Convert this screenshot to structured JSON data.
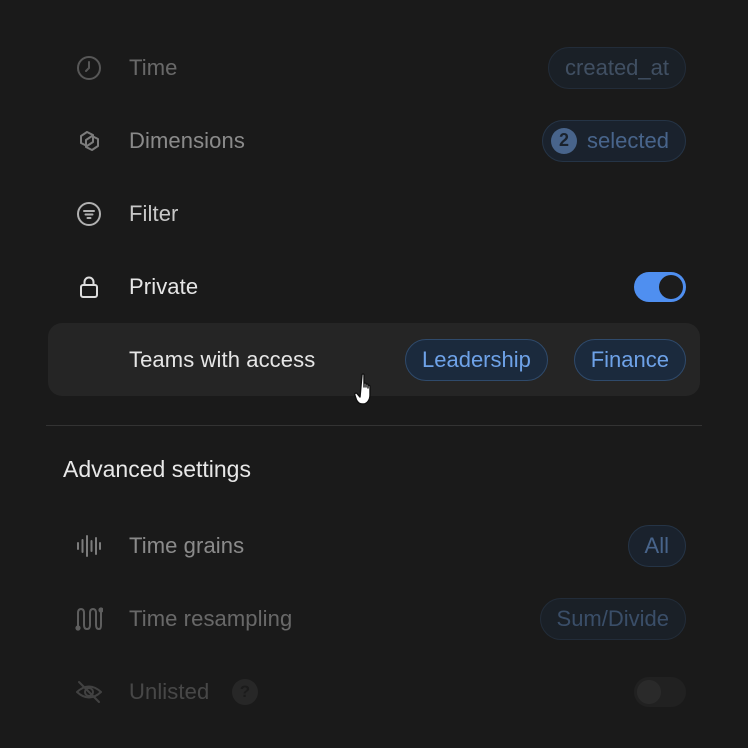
{
  "rows": {
    "time": {
      "label": "Time",
      "value": "created_at"
    },
    "dimensions": {
      "label": "Dimensions",
      "count": "2",
      "value": "selected"
    },
    "filter": {
      "label": "Filter"
    },
    "private": {
      "label": "Private",
      "toggle": "on"
    },
    "teams": {
      "label": "Teams with access",
      "pills": [
        "Leadership",
        "Finance"
      ]
    }
  },
  "advanced": {
    "title": "Advanced settings",
    "time_grains": {
      "label": "Time grains",
      "value": "All"
    },
    "time_resampling": {
      "label": "Time resampling",
      "value": "Sum/Divide"
    },
    "unlisted": {
      "label": "Unlisted",
      "help": "?",
      "toggle": "off"
    }
  },
  "icons": [
    "clock-icon",
    "cubes-icon",
    "filter-icon",
    "lock-icon",
    "waveform-icon",
    "resample-icon",
    "eye-off-icon",
    "pointer-cursor-icon"
  ],
  "colors": {
    "accent": "#4f8ff0",
    "pill_text": "#6ea2e8",
    "pill_bg": "#1b2a3d",
    "background": "#1a1a1a"
  }
}
